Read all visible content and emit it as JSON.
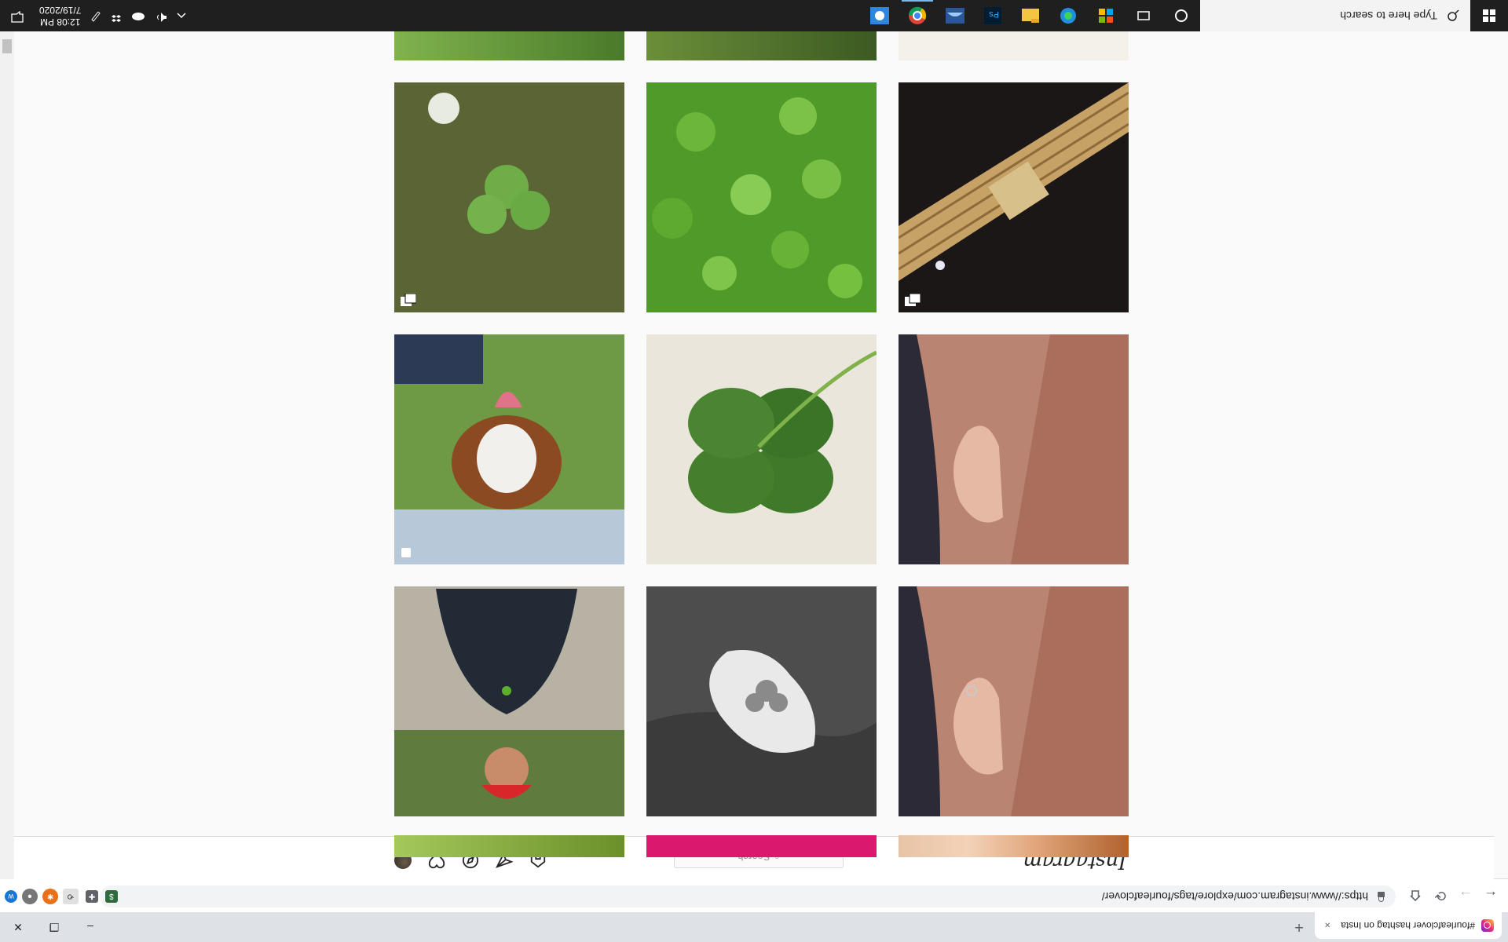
{
  "browser": {
    "tab_title": "#fourleafclover hashtag on Insta",
    "tab_close": "×",
    "new_tab": "+",
    "url": "https://www.instagram.com/explore/tags/fourleafclover/",
    "back": "←",
    "forward": "→",
    "reload": "⟳",
    "profile_letter": "Z",
    "window_min": "–",
    "window_max": "❐",
    "window_close": "✕"
  },
  "instagram": {
    "logo": "Instagram",
    "search_placeholder": "Search",
    "search_icon": "⌕"
  },
  "posts": [
    {
      "id": "r1c1",
      "desc": "clover",
      "badge": "multi"
    },
    {
      "id": "r1c2",
      "desc": "clover-field",
      "badge": ""
    },
    {
      "id": "r1c3",
      "desc": "gold-bracelet",
      "badge": "multi"
    },
    {
      "id": "r2c1",
      "desc": "dog",
      "badge": "single"
    },
    {
      "id": "r2c2",
      "desc": "four-leaf-clover",
      "badge": ""
    },
    {
      "id": "r2c3",
      "desc": "ear-tattoo",
      "badge": ""
    },
    {
      "id": "r3c1",
      "desc": "man-red-hat",
      "badge": ""
    },
    {
      "id": "r3c2",
      "desc": "bw-hand-clover",
      "badge": ""
    },
    {
      "id": "r3c3",
      "desc": "ear-tattoo-2",
      "badge": ""
    }
  ],
  "taskbar": {
    "search_placeholder": "Type here to search",
    "time": "12:08 PM",
    "date": "7/19/2020"
  },
  "colors": {
    "ig_border": "#dbdbdb",
    "taskbar_bg": "#1f1f1f",
    "chrome_tabbar": "#dee1e6"
  }
}
